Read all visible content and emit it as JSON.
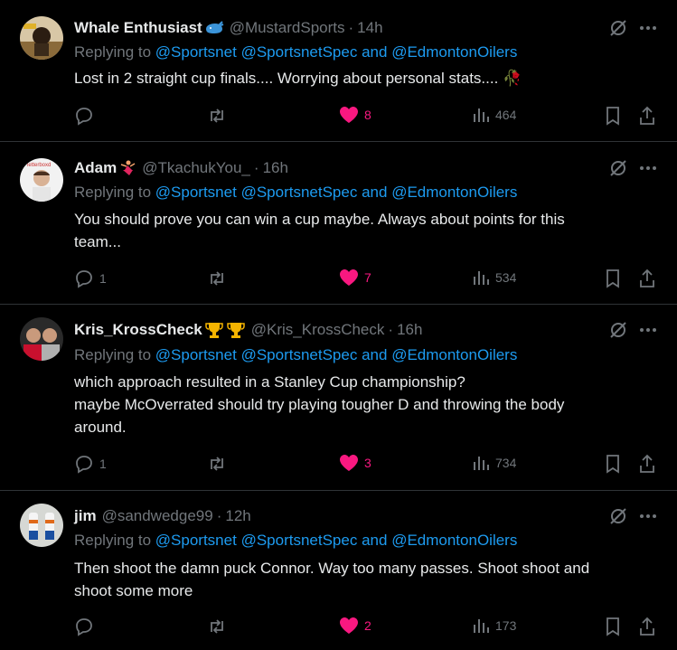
{
  "reply_prefix": "Replying to",
  "tweets": [
    {
      "name": "Whale Enthusiast",
      "name_emoji": "whale-emoji",
      "handle": "@MustardSports",
      "time": "14h",
      "reply_to": [
        "@Sportsnet",
        "@SportsnetSpec",
        "and",
        "@EdmontonOilers"
      ],
      "text": [
        "Lost in 2 straight cup finals.... Worrying about personal stats.... 🥀"
      ],
      "replies": "",
      "likes": "8",
      "views": "464",
      "liked": true
    },
    {
      "name": "Adam",
      "name_emoji": "dancer-emoji",
      "handle": "@TkachukYou_",
      "time": "16h",
      "reply_to": [
        "@Sportsnet",
        "@SportsnetSpec",
        "and",
        "@EdmontonOilers"
      ],
      "text": [
        "You should prove you can win a cup maybe. Always about points for this",
        "team..."
      ],
      "replies": "1",
      "likes": "7",
      "views": "534",
      "liked": true
    },
    {
      "name": "Kris_KrossCheck",
      "name_emoji": "trophy-emoji",
      "handle": "@Kris_KrossCheck",
      "time": "16h",
      "reply_to": [
        "@Sportsnet",
        "@SportsnetSpec",
        "and",
        "@EdmontonOilers"
      ],
      "text": [
        "which approach resulted in a Stanley Cup championship?",
        "maybe McOverrated should try playing tougher D and throwing the body",
        "around."
      ],
      "replies": "1",
      "likes": "3",
      "views": "734",
      "liked": true
    },
    {
      "name": "jim",
      "name_emoji": "",
      "handle": "@sandwedge99",
      "time": "12h",
      "reply_to": [
        "@Sportsnet",
        "@SportsnetSpec",
        "and",
        "@EdmontonOilers"
      ],
      "text": [
        "Then shoot the damn puck Connor. Way too many passes. Shoot shoot and",
        "shoot some more"
      ],
      "replies": "",
      "likes": "2",
      "views": "173",
      "liked": true
    }
  ],
  "colors": {
    "background": "#000000",
    "text": "#e7e9ea",
    "muted": "#71767b",
    "link": "#1d9bf0",
    "like": "#f91880",
    "divider": "#2f3336"
  }
}
